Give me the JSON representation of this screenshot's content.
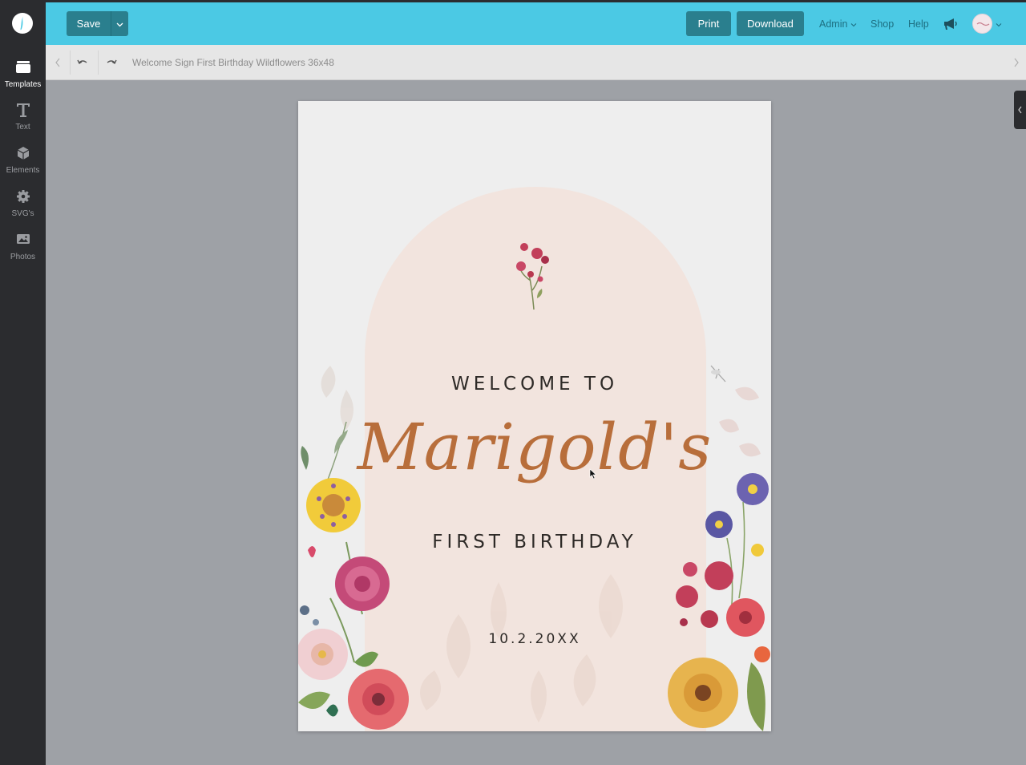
{
  "sidebar": {
    "items": [
      {
        "label": "Templates",
        "icon": "templates-icon"
      },
      {
        "label": "Text",
        "icon": "text-icon"
      },
      {
        "label": "Elements",
        "icon": "cube-icon"
      },
      {
        "label": "SVG's",
        "icon": "gear-icon"
      },
      {
        "label": "Photos",
        "icon": "photo-icon"
      }
    ]
  },
  "toolbar": {
    "save_label": "Save",
    "print_label": "Print",
    "download_label": "Download",
    "admin_label": "Admin",
    "shop_label": "Shop",
    "help_label": "Help"
  },
  "document": {
    "title": "Welcome Sign First Birthday Wildflowers 36x48"
  },
  "design": {
    "welcome": "WELCOME TO",
    "name": "Marigold's",
    "birthday": "FIRST BIRTHDAY",
    "date": "10.2.20XX"
  },
  "colors": {
    "topbar": "#4bc9e4",
    "button": "#2a7f8e",
    "rail": "#2b2c2f",
    "arch": "#f2e4de",
    "name_text": "#b86e3b"
  }
}
